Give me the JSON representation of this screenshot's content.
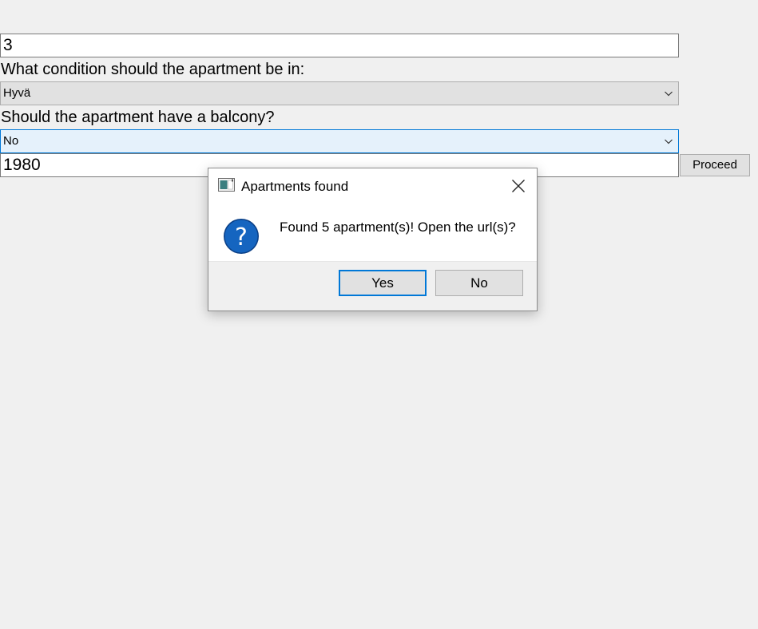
{
  "form": {
    "rooms_value": "3",
    "condition_label": "What condition should the apartment be in:",
    "condition_selected": "Hyvä",
    "balcony_label": "Should the apartment have a balcony?",
    "balcony_selected": "No",
    "year_value": "1980",
    "proceed_label": "Proceed"
  },
  "dialog": {
    "title": "Apartments found",
    "message": "Found 5 apartment(s)! Open the url(s)?",
    "yes_label": "Yes",
    "no_label": "No",
    "icons": {
      "app": "app-window-icon",
      "close": "close-icon",
      "question": "question-icon"
    }
  },
  "colors": {
    "window_bg": "#f0f0f0",
    "focus_accent": "#0078d7",
    "question_blue": "#1565c0"
  }
}
